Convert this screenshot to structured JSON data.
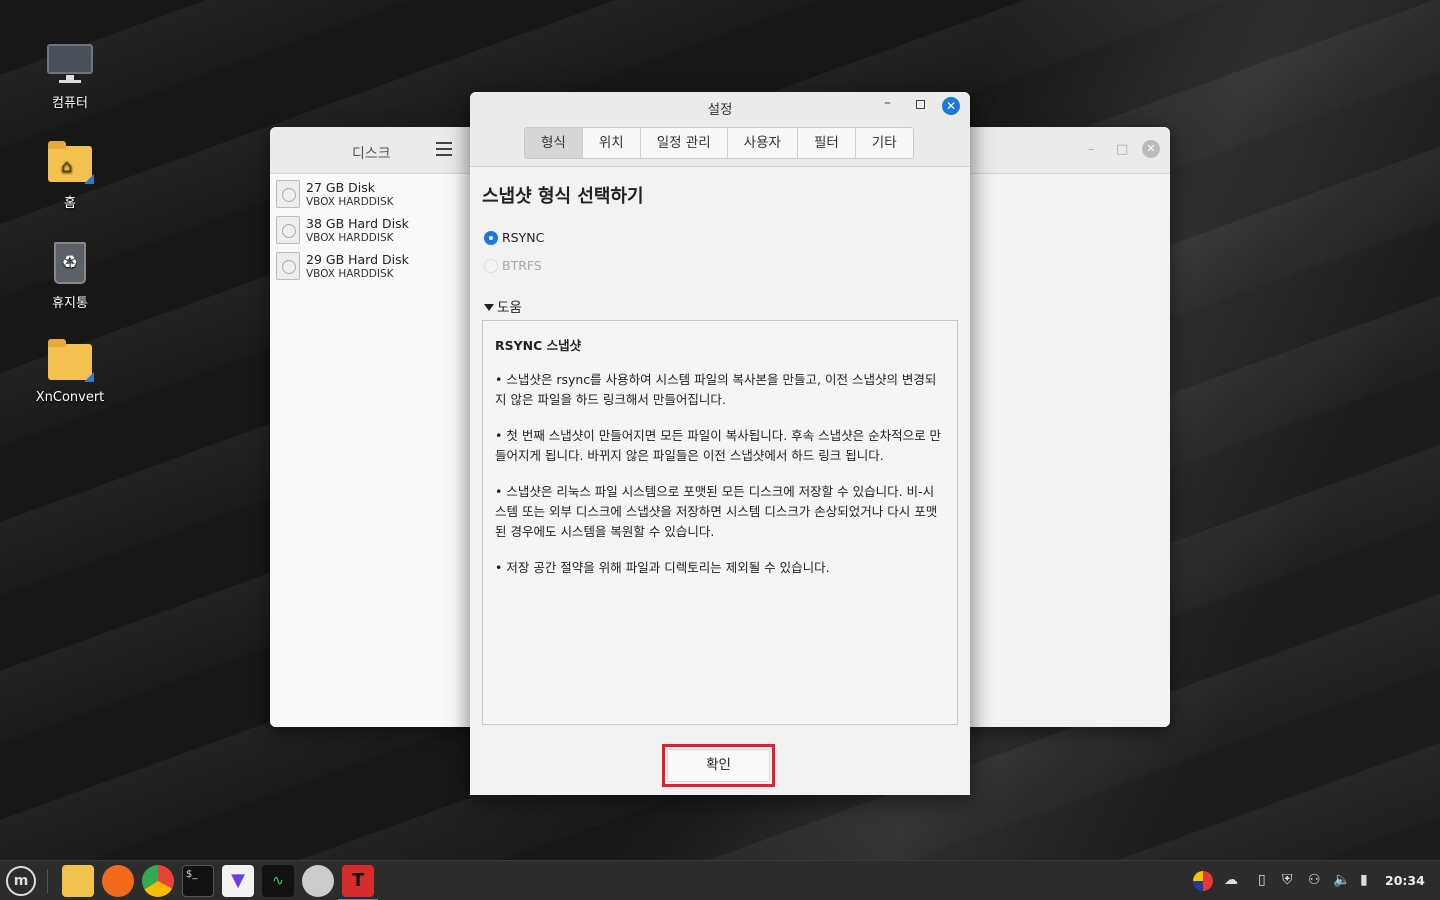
{
  "desktop": {
    "icons": [
      {
        "label": "컴퓨터"
      },
      {
        "label": "홈"
      },
      {
        "label": "휴지통"
      },
      {
        "label": "XnConvert"
      }
    ]
  },
  "disks_window": {
    "title": "디스크",
    "disks": [
      {
        "name": "27 GB Disk",
        "model": "VBOX HARDDISK"
      },
      {
        "name": "38 GB Hard Disk",
        "model": "VBOX HARDDISK"
      },
      {
        "name": "29 GB Hard Disk",
        "model": "VBOX HARDDISK"
      }
    ],
    "controls": {
      "minimize": "–",
      "maximize": "□",
      "close": "✕"
    }
  },
  "settings": {
    "title": "설정",
    "controls": {
      "minimize": "–",
      "close": "✕"
    },
    "tabs": [
      {
        "label": "형식",
        "active": true
      },
      {
        "label": "위치"
      },
      {
        "label": "일정 관리"
      },
      {
        "label": "사용자"
      },
      {
        "label": "필터"
      },
      {
        "label": "기타"
      }
    ],
    "section_title": "스냅샷 형식 선택하기",
    "options": [
      {
        "label": "RSYNC",
        "checked": true
      },
      {
        "label": "BTRFS",
        "checked": false,
        "disabled": true
      }
    ],
    "help_toggle": "도움",
    "help": {
      "heading": "RSYNC 스냅샷",
      "paragraphs": [
        "• 스냅샷은 rsync를 사용하여 시스템 파일의 복사본을 만들고, 이전 스냅샷의 변경되지 않은 파일을 하드 링크해서 만들어집니다.",
        "• 첫 번째 스냅샷이 만들어지면 모든 파일이 복사됩니다. 후속 스냅샷은 순차적으로 만들어지게 됩니다. 바뀌지 않은 파일들은 이전 스냅샷에서 하드 링크 됩니다.",
        "• 스냅샷은 리눅스 파일 시스템으로 포맷된 모든 디스크에 저장할 수 있습니다. 비-시스템 또는 외부 디스크에 스냅샷을 저장하면 시스템 디스크가 손상되었거나 다시 포맷된 경우에도 시스템을 복원할 수 있습니다.",
        "• 저장 공간 절약을 위해 파일과 디렉토리는 제외될 수 있습니다."
      ]
    },
    "ok_label": "확인"
  },
  "taskbar": {
    "clock": "20:34",
    "colors": {
      "accent": "#1e78d6",
      "highlight": "#e0202a"
    }
  }
}
